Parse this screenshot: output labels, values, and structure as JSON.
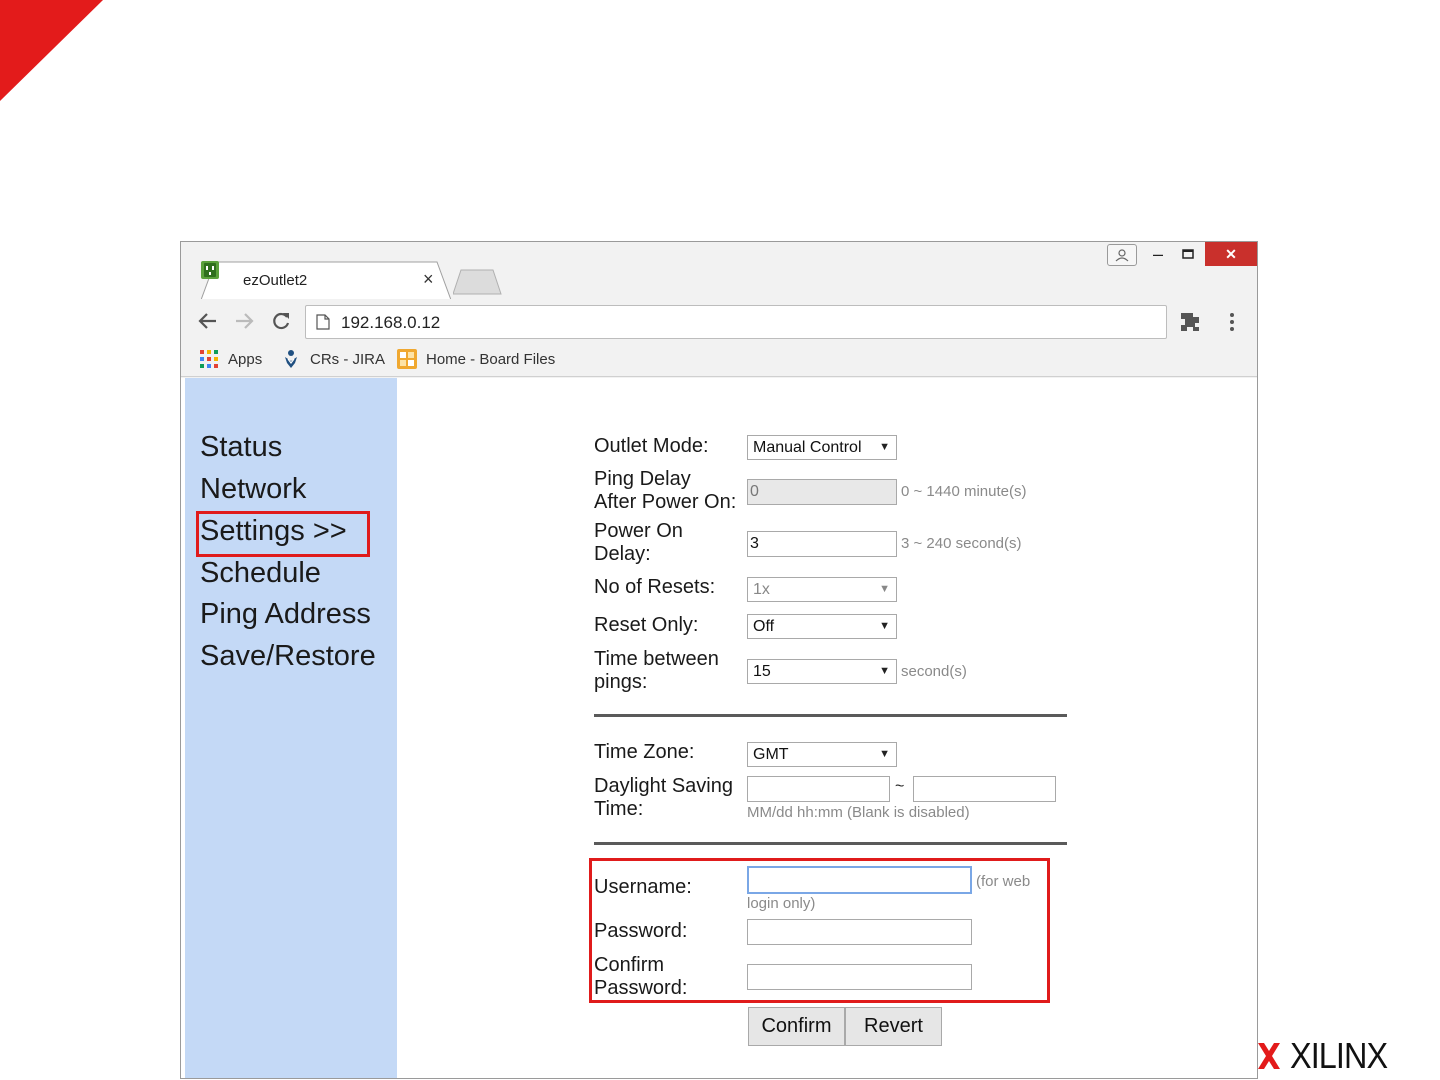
{
  "brand": {
    "logo_text": "XILINX",
    "accent_color": "#e31b1b"
  },
  "browser": {
    "tab": {
      "title": "ezOutlet2",
      "close_glyph": "×",
      "icon": "outlet-icon"
    },
    "window_controls": {
      "minimize": "‒",
      "close": "✕"
    },
    "toolbar": {
      "url": "192.168.0.12"
    },
    "bookmarks": [
      {
        "label": "Apps",
        "icon": "apps-grid-icon"
      },
      {
        "label": "CRs - JIRA",
        "icon": "jira-icon"
      },
      {
        "label": "Home - Board Files",
        "icon": "board-files-icon"
      }
    ]
  },
  "sidebar": {
    "items": [
      {
        "label": "Status"
      },
      {
        "label": "Network"
      },
      {
        "label": "Settings >>",
        "active": true
      },
      {
        "label": "Schedule"
      },
      {
        "label": "Ping Address"
      },
      {
        "label": "Save/Restore"
      }
    ]
  },
  "form": {
    "outlet_mode": {
      "label": "Outlet Mode:",
      "value": "Manual Control"
    },
    "ping_delay": {
      "label_line1": "Ping Delay",
      "label_line2": "After Power On:",
      "value": "0",
      "hint": "0 ~ 1440 minute(s)"
    },
    "power_on_delay": {
      "label_line1": "Power On",
      "label_line2": "Delay:",
      "value": "3",
      "hint": "3 ~ 240 second(s)"
    },
    "no_of_resets": {
      "label": "No of Resets:",
      "value": "1x"
    },
    "reset_only": {
      "label": "Reset Only:",
      "value": "Off"
    },
    "time_between_pings": {
      "label_line1": "Time between",
      "label_line2": "pings:",
      "value": "15",
      "hint": "second(s)"
    },
    "time_zone": {
      "label": "Time Zone:",
      "value": "GMT"
    },
    "daylight_saving": {
      "label_line1": "Daylight Saving",
      "label_line2": "Time:",
      "start": "",
      "end": "",
      "separator": "~",
      "hint": "MM/dd hh:mm (Blank is disabled)"
    },
    "username": {
      "label": "Username:",
      "value": "",
      "hint_line1": "(for web",
      "hint_line2": "login only)"
    },
    "password": {
      "label": "Password:",
      "value": ""
    },
    "confirm_password": {
      "label_line1": "Confirm",
      "label_line2": "Password:",
      "value": ""
    },
    "buttons": {
      "confirm": "Confirm",
      "revert": "Revert"
    }
  }
}
